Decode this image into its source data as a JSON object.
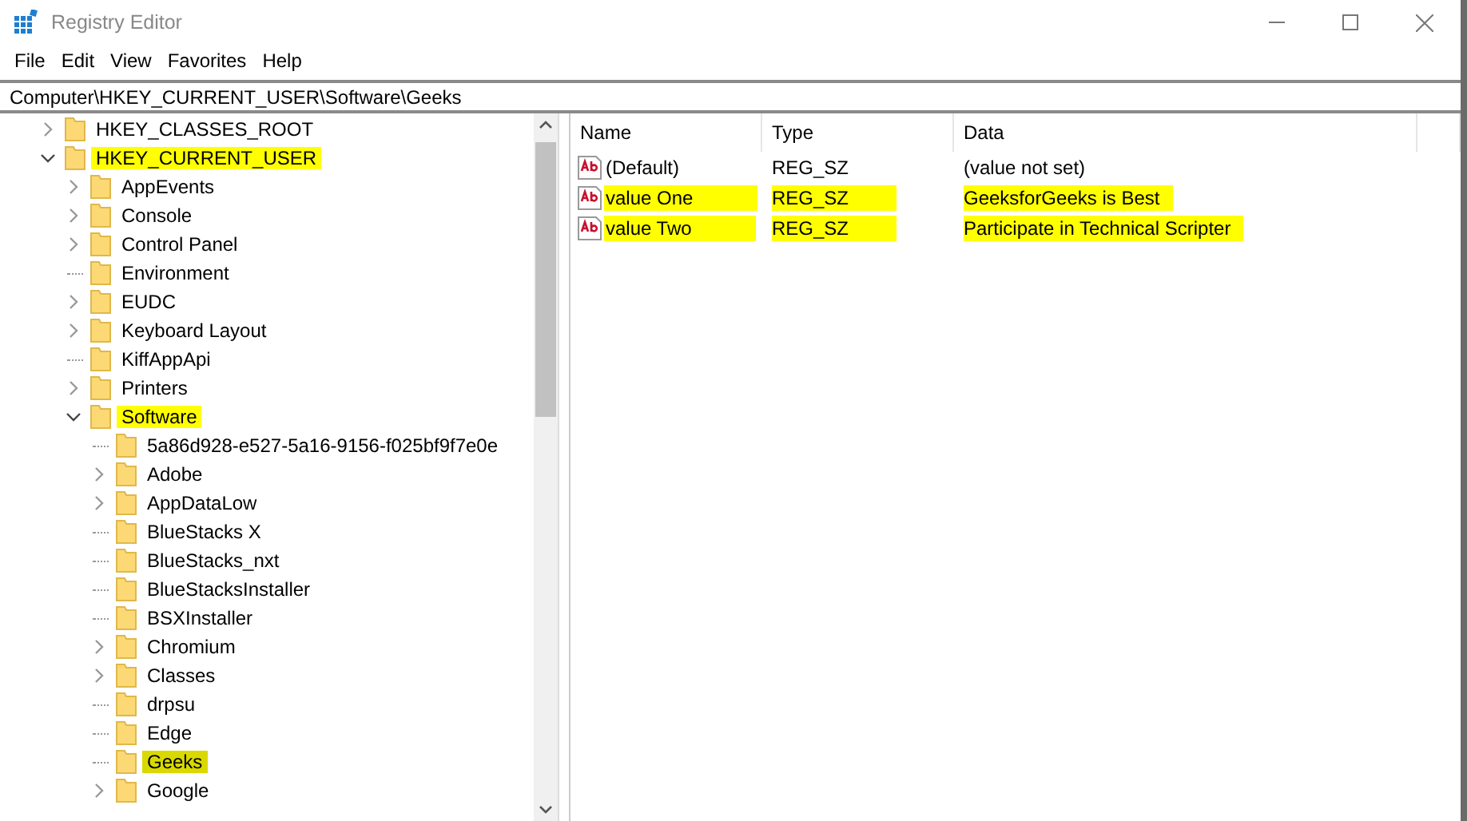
{
  "window": {
    "title": "Registry Editor"
  },
  "menu": [
    "File",
    "Edit",
    "View",
    "Favorites",
    "Help"
  ],
  "address": {
    "value": "Computer\\HKEY_CURRENT_USER\\Software\\Geeks"
  },
  "tree": [
    {
      "label": "HKEY_CLASSES_ROOT",
      "expandable": true,
      "expanded": false,
      "highlighted": false,
      "selected": false
    },
    {
      "label": "HKEY_CURRENT_USER",
      "expandable": true,
      "expanded": true,
      "highlighted": true,
      "selected": false,
      "children": [
        {
          "label": "AppEvents",
          "expandable": true,
          "expanded": false,
          "highlighted": false,
          "selected": false
        },
        {
          "label": "Console",
          "expandable": true,
          "expanded": false,
          "highlighted": false,
          "selected": false
        },
        {
          "label": "Control Panel",
          "expandable": true,
          "expanded": false,
          "highlighted": false,
          "selected": false
        },
        {
          "label": "Environment",
          "expandable": false,
          "highlighted": false,
          "selected": false
        },
        {
          "label": "EUDC",
          "expandable": true,
          "expanded": false,
          "highlighted": false,
          "selected": false
        },
        {
          "label": "Keyboard Layout",
          "expandable": true,
          "expanded": false,
          "highlighted": false,
          "selected": false
        },
        {
          "label": "KiffAppApi",
          "expandable": false,
          "highlighted": false,
          "selected": false
        },
        {
          "label": "Printers",
          "expandable": true,
          "expanded": false,
          "highlighted": false,
          "selected": false
        },
        {
          "label": "Software",
          "expandable": true,
          "expanded": true,
          "highlighted": true,
          "selected": false,
          "children": [
            {
              "label": "5a86d928-e527-5a16-9156-f025bf9f7e0e",
              "expandable": false,
              "highlighted": false,
              "selected": false
            },
            {
              "label": "Adobe",
              "expandable": true,
              "expanded": false,
              "highlighted": false,
              "selected": false
            },
            {
              "label": "AppDataLow",
              "expandable": true,
              "expanded": false,
              "highlighted": false,
              "selected": false
            },
            {
              "label": "BlueStacks X",
              "expandable": false,
              "highlighted": false,
              "selected": false
            },
            {
              "label": "BlueStacks_nxt",
              "expandable": false,
              "highlighted": false,
              "selected": false
            },
            {
              "label": "BlueStacksInstaller",
              "expandable": false,
              "highlighted": false,
              "selected": false
            },
            {
              "label": "BSXInstaller",
              "expandable": false,
              "highlighted": false,
              "selected": false
            },
            {
              "label": "Chromium",
              "expandable": true,
              "expanded": false,
              "highlighted": false,
              "selected": false
            },
            {
              "label": "Classes",
              "expandable": true,
              "expanded": false,
              "highlighted": false,
              "selected": false
            },
            {
              "label": "drpsu",
              "expandable": false,
              "highlighted": false,
              "selected": false
            },
            {
              "label": "Edge",
              "expandable": false,
              "highlighted": false,
              "selected": false
            },
            {
              "label": "Geeks",
              "expandable": false,
              "highlighted": true,
              "selected": true
            },
            {
              "label": "Google",
              "expandable": true,
              "expanded": false,
              "highlighted": false,
              "selected": false
            }
          ]
        }
      ]
    }
  ],
  "values": {
    "columns": [
      "Name",
      "Type",
      "Data"
    ],
    "rows": [
      {
        "name": "(Default)",
        "type": "REG_SZ",
        "data": "(value not set)",
        "highlighted": false
      },
      {
        "name": "value One",
        "type": "REG_SZ",
        "data": "GeeksforGeeks is Best",
        "highlighted": true
      },
      {
        "name": "value Two",
        "type": "REG_SZ",
        "data": "Participate in Technical Scripter",
        "highlighted": true
      }
    ]
  }
}
